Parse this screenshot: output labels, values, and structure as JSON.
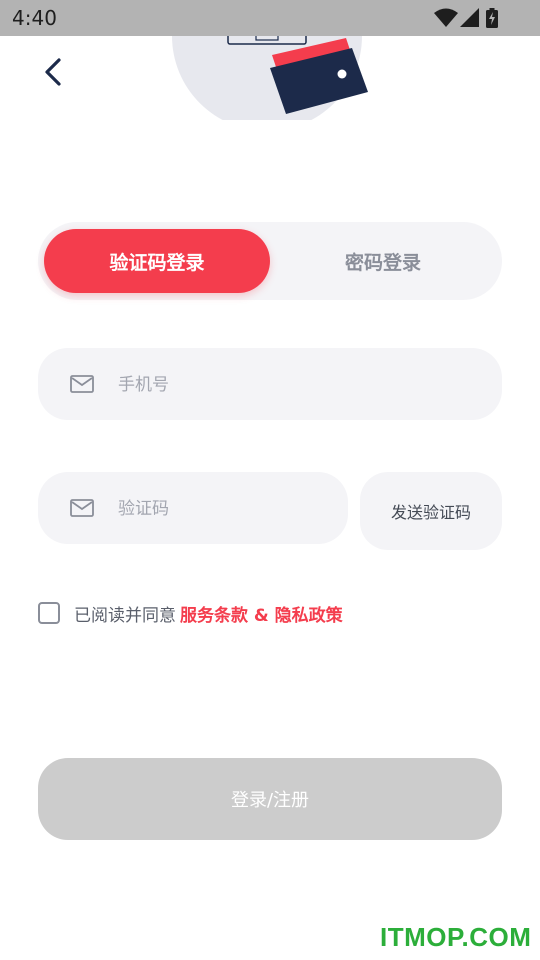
{
  "status_bar": {
    "time": "4:40"
  },
  "tabs": [
    {
      "label": "验证码登录",
      "active": true
    },
    {
      "label": "密码登录",
      "active": false
    }
  ],
  "form": {
    "phone_placeholder": "手机号",
    "code_placeholder": "验证码",
    "send_code_label": "发送验证码"
  },
  "agreement": {
    "text": "已阅读并同意",
    "link": "服务条款 & 隐私政策"
  },
  "submit_label": "登录/注册",
  "watermark": "ITMOP.COM",
  "colors": {
    "accent": "#f43d4d",
    "field_bg": "#f4f4f7",
    "disabled": "#cccccc"
  }
}
